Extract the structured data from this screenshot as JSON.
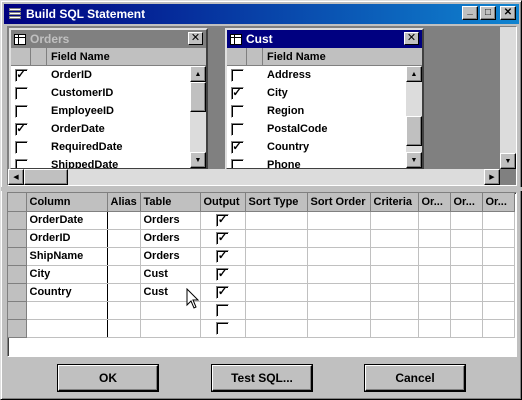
{
  "window": {
    "title": "Build SQL Statement",
    "buttons": [
      "_",
      "□",
      "✕"
    ]
  },
  "tables": [
    {
      "title": "Orders",
      "active": false,
      "header": "Field Name",
      "fields": [
        {
          "name": "OrderID",
          "checked": true
        },
        {
          "name": "CustomerID",
          "checked": false
        },
        {
          "name": "EmployeeID",
          "checked": false
        },
        {
          "name": "OrderDate",
          "checked": true
        },
        {
          "name": "RequiredDate",
          "checked": false
        },
        {
          "name": "ShippedDate",
          "checked": false
        }
      ]
    },
    {
      "title": "Cust",
      "active": true,
      "header": "Field Name",
      "fields": [
        {
          "name": "Address",
          "checked": false
        },
        {
          "name": "City",
          "checked": true
        },
        {
          "name": "Region",
          "checked": false
        },
        {
          "name": "PostalCode",
          "checked": false
        },
        {
          "name": "Country",
          "checked": true
        },
        {
          "name": "Phone",
          "checked": false
        }
      ]
    }
  ],
  "grid": {
    "columns": [
      "Column",
      "Alias",
      "Table",
      "Output",
      "Sort Type",
      "Sort Order",
      "Criteria",
      "Or...",
      "Or...",
      "Or..."
    ],
    "rows": [
      {
        "column": "OrderDate",
        "alias": "",
        "table": "Orders",
        "output": true
      },
      {
        "column": "OrderID",
        "alias": "",
        "table": "Orders",
        "output": true
      },
      {
        "column": "ShipName",
        "alias": "",
        "table": "Orders",
        "output": true
      },
      {
        "column": "City",
        "alias": "",
        "table": "Cust",
        "output": true
      },
      {
        "column": "Country",
        "alias": "",
        "table": "Cust",
        "output": true
      },
      {
        "column": "",
        "alias": "",
        "table": "",
        "output": false
      },
      {
        "column": "",
        "alias": "",
        "table": "",
        "output": false
      }
    ]
  },
  "buttons": {
    "ok": "OK",
    "test_sql": "Test SQL...",
    "cancel": "Cancel"
  },
  "colors": {
    "title_active": "#000080",
    "face": "#c0c0c0",
    "shadow": "#808080"
  }
}
